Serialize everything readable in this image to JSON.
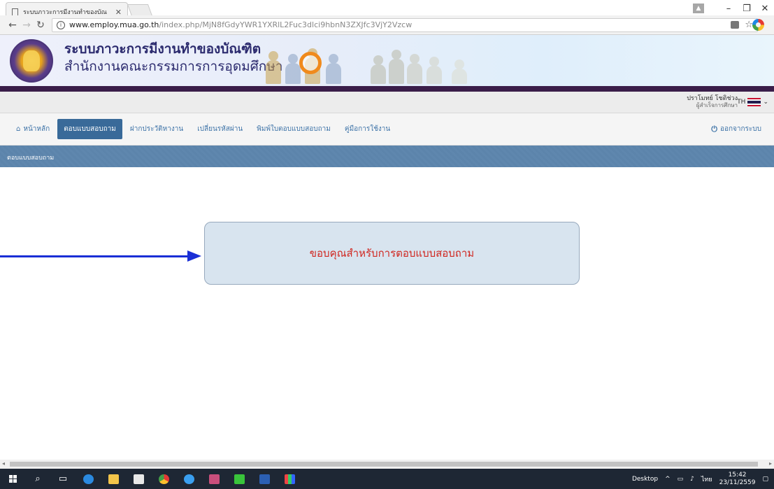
{
  "browser": {
    "tab_title": "ระบบภาวะการมีงานทำของบัณ",
    "url_host": "www.employ.mua.go.th",
    "url_path": "/index.php/MjN8fGdyYWR1YXRlL2Fuc3dlci9hbnN3ZXJfc3VjY2Vzcw"
  },
  "site": {
    "title": "ระบบภาวะการมีงานทำของบัณฑิต",
    "subtitle": "สำนักงานคณะกรรมการการอุดมศึกษา"
  },
  "user": {
    "name": "ปราโมทย์ โชติช่วง",
    "role": "ผู้สำเร็จการศึกษา",
    "lang": "TH"
  },
  "nav": {
    "items": [
      {
        "label": "หน้าหลัก"
      },
      {
        "label": "ตอบแบบสอบถาม"
      },
      {
        "label": "ฝากประวัติหางาน"
      },
      {
        "label": "เปลี่ยนรหัสผ่าน"
      },
      {
        "label": "พิมพ์ใบตอบแบบสอบถาม"
      },
      {
        "label": "คู่มือการใช้งาน"
      }
    ],
    "active_index": 1,
    "logout": "ออกจากระบบ"
  },
  "page": {
    "header": "ตอบแบบสอบถาม",
    "message": "ขอบคุณสำหรับการตอบแบบสอบถาม"
  },
  "taskbar": {
    "desktop_label": "Desktop",
    "input_lang": "ไทย",
    "time": "15:42",
    "date": "23/11/2559"
  },
  "colors": {
    "active_nav": "#396a99",
    "message_text": "#d0261f",
    "annotation_arrow": "#1a2fd6"
  }
}
